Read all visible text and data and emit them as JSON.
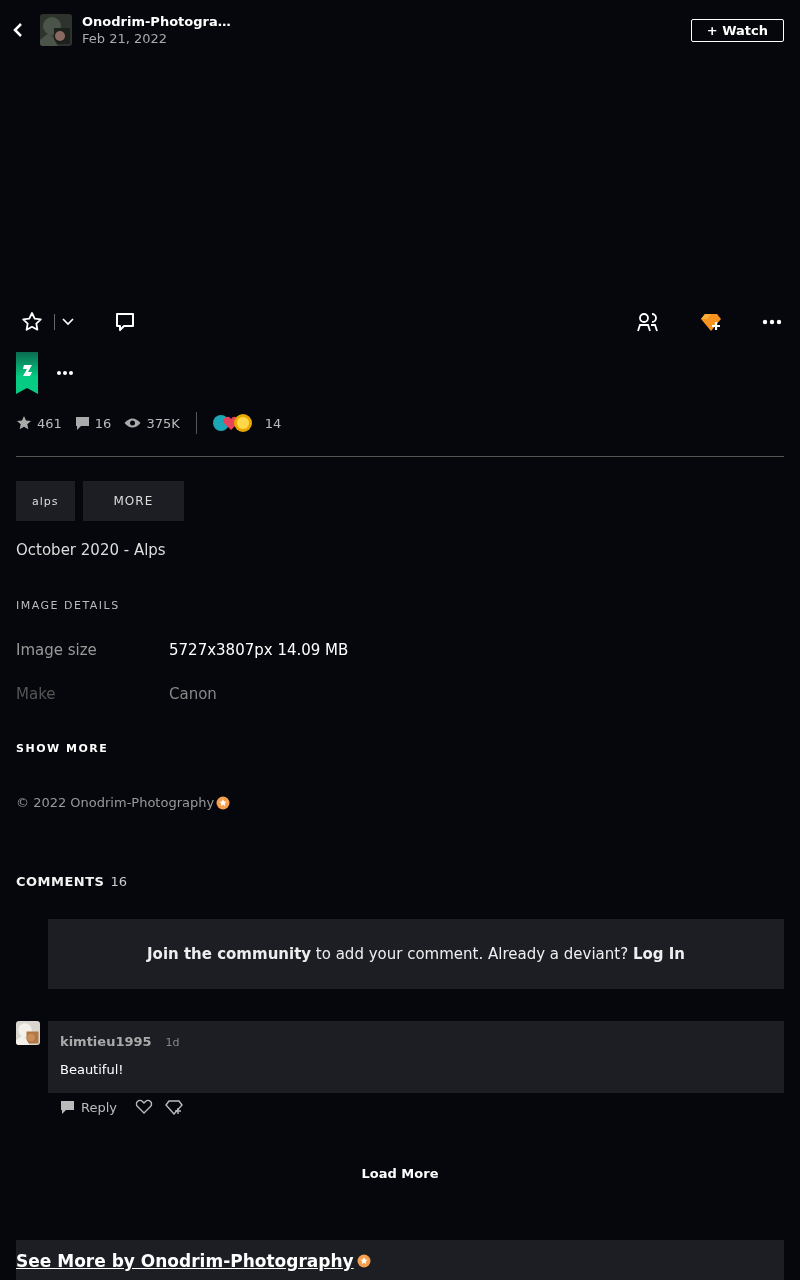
{
  "header": {
    "author": "Onodrim-Photogra…",
    "date": "Feb 21, 2022",
    "watch_button": "+ Watch"
  },
  "actions": {
    "favourited": false
  },
  "stats": {
    "favourites": "461",
    "comments": "16",
    "views": "375K",
    "awards": "14"
  },
  "tags": [
    {
      "label": "alps",
      "kind": "tag"
    },
    {
      "label": "MORE",
      "kind": "more"
    }
  ],
  "description": "October 2020 - Alps",
  "image_details": {
    "heading": "IMAGE DETAILS",
    "rows": [
      {
        "label": "Image size",
        "value": "5727x3807px 14.09 MB",
        "faded": false
      },
      {
        "label": "Make",
        "value": "Canon",
        "faded": true
      }
    ],
    "show_more": "SHOW MORE"
  },
  "copyright": "© 2022 Onodrim-Photography",
  "comments": {
    "heading": "COMMENTS",
    "count": "16",
    "join_text": "**Join the community** to add your comment. Already a deviant? **Log In**",
    "items": [
      {
        "user": "kimtieu1995",
        "time": "1d",
        "text": "Beautiful!",
        "reply": "Reply",
        "liked": false
      }
    ],
    "load_more": "Load More"
  },
  "see_more": "See More by Onodrim-Photography"
}
